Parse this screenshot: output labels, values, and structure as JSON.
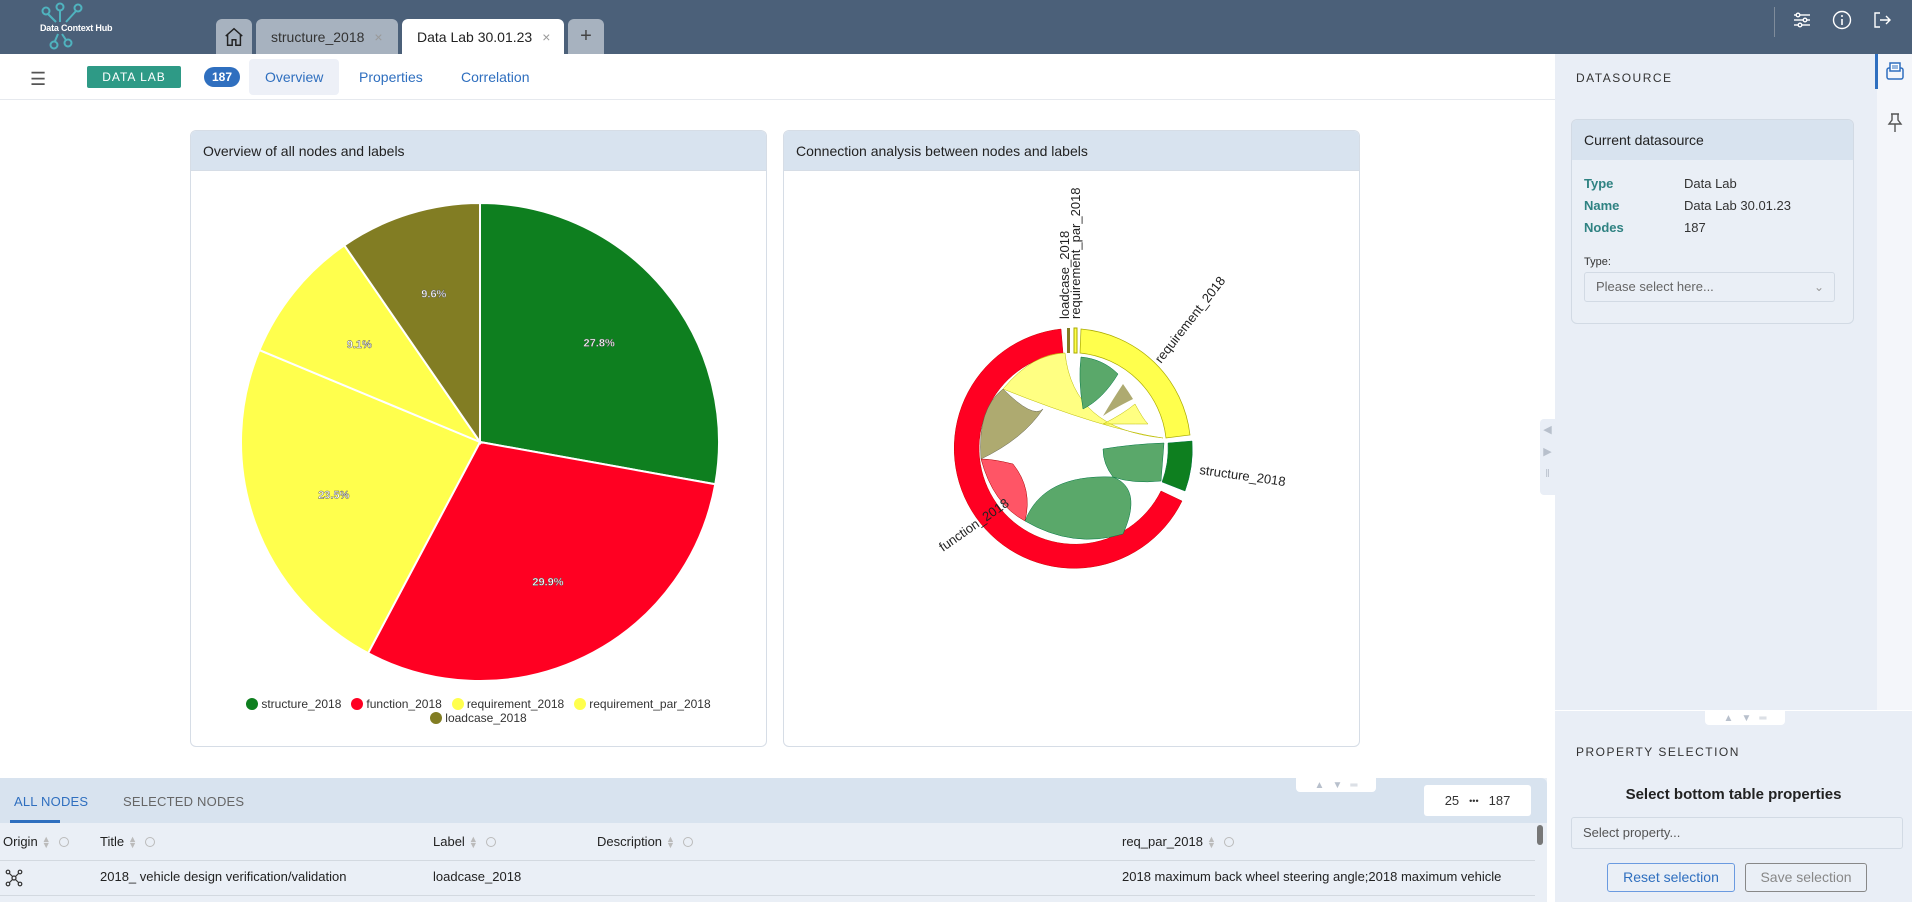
{
  "app": {
    "logo_text": "Data Context Hub"
  },
  "tabs": [
    {
      "label": "structure_2018",
      "active": false
    },
    {
      "label": "Data Lab 30.01.23",
      "active": true
    }
  ],
  "tab_add_label": "+",
  "close_glyph": "×",
  "subnav": {
    "badge": "DATA LAB",
    "count": "187",
    "tabs": [
      {
        "label": "Overview",
        "active": true
      },
      {
        "label": "Properties",
        "active": false
      },
      {
        "label": "Correlation",
        "active": false
      }
    ]
  },
  "pie_panel": {
    "title": "Overview of all nodes and labels"
  },
  "chord_panel": {
    "title": "Connection analysis between nodes and labels"
  },
  "chart_data": [
    {
      "type": "pie",
      "title": "Overview of all nodes and labels",
      "categories": [
        "structure_2018",
        "function_2018",
        "requirement_2018",
        "requirement_par_2018",
        "loadcase_2018"
      ],
      "values": [
        27.8,
        29.9,
        23.5,
        9.1,
        9.6
      ],
      "labels": [
        "27.8%",
        "29.9%",
        "23.5%",
        "9.1%",
        "9.6%"
      ],
      "colors": [
        "#0e7f1f",
        "#ff0022",
        "#ffff4d",
        "#ffff4d",
        "#827d23"
      ],
      "legend": "bottom"
    },
    {
      "type": "chord",
      "title": "Connection analysis between nodes and labels",
      "groups": [
        "function_2018",
        "loadcase_2018",
        "requirement_par_2018",
        "requirement_2018",
        "structure_2018"
      ],
      "group_shares": [
        0.62,
        0.006,
        0.006,
        0.2,
        0.1
      ],
      "colors": [
        "#ff0022",
        "#827d23",
        "#ffff4d",
        "#ffff4d",
        "#0e7f1f"
      ]
    }
  ],
  "sidebar": {
    "title": "DATASOURCE",
    "card_title": "Current datasource",
    "fields": [
      {
        "key": "Type",
        "value": "Data Lab"
      },
      {
        "key": "Name",
        "value": "Data Lab 30.01.23"
      },
      {
        "key": "Nodes",
        "value": "187"
      }
    ],
    "type_label": "Type:",
    "type_placeholder": "Please select here..."
  },
  "property_selection": {
    "title": "PROPERTY SELECTION",
    "heading": "Select bottom table properties",
    "placeholder": "Select property...",
    "reset_label": "Reset selection",
    "save_label": "Save selection"
  },
  "bottom_table": {
    "tabs": [
      {
        "label": "ALL NODES",
        "active": true
      },
      {
        "label": "SELECTED NODES",
        "active": false
      }
    ],
    "pager": {
      "page_size": "25",
      "dots": "•••",
      "total": "187"
    },
    "columns": [
      "Origin",
      "Title",
      "Label",
      "Description",
      "req_par_2018"
    ],
    "rows": [
      {
        "origin_icon": "graph-node-icon",
        "title": "2018_ vehicle design verification/validation",
        "label": "loadcase_2018",
        "description": "",
        "req_par_2018": "2018 maximum back wheel steering angle;2018 maximum vehicle"
      }
    ]
  }
}
